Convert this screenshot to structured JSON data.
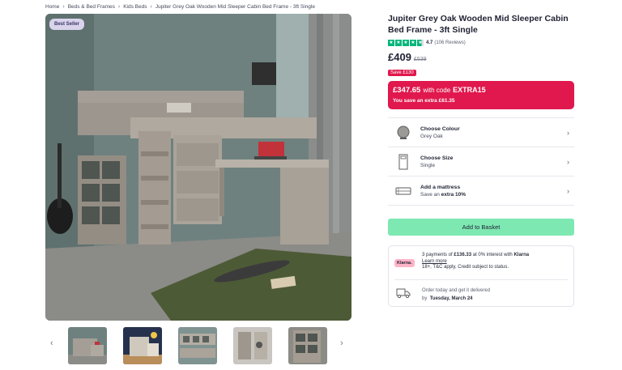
{
  "breadcrumb": {
    "items": [
      "Home",
      "Beds & Bed Frames",
      "Kids Beds",
      "Jupiter Grey Oak Wooden Mid Sleeper Cabin Bed Frame - 3ft Single"
    ],
    "separator": "›"
  },
  "gallery": {
    "badge": "Best Seller",
    "prev_arrow": "‹",
    "next_arrow": "›",
    "thumbnail_count": 5
  },
  "product": {
    "title": "Jupiter Grey Oak Wooden Mid Sleeper Cabin Bed Frame - 3ft Single",
    "rating_value": "4.7",
    "rating_stars": 4.7,
    "review_count": "(106 Reviews)",
    "price": "£409",
    "was_price": "£539",
    "save_text": "Save £130"
  },
  "promo": {
    "price": "£347.65",
    "with_code_label": "with code",
    "code": "EXTRA15",
    "extra_saving": "You save an extra £61.35"
  },
  "options": [
    {
      "label": "Choose Colour",
      "value": "Grey Oak",
      "icon": "colour-swatch-icon"
    },
    {
      "label": "Choose Size",
      "value": "Single",
      "icon": "size-icon"
    },
    {
      "label": "Add a mattress",
      "value_prefix": "Save an",
      "value_bold": "extra 10%",
      "icon": "mattress-icon"
    }
  ],
  "actions": {
    "add_to_basket": "Add to Basket"
  },
  "finance": {
    "klarna_logo": "Klarna.",
    "line1_prefix": "3 payments of",
    "line1_amount": "£136.33",
    "line1_middle": "at 0% interest with",
    "line1_brand": "Klarna",
    "learn_more": "Learn more",
    "line2": "18+, T&C apply, Credit subject to status."
  },
  "delivery": {
    "line1": "Order today and get it delivered",
    "by_label": "by",
    "date": "Tuesday, March 24"
  },
  "colors": {
    "promo_red": "#e0184d",
    "basket_green": "#7ee8b3",
    "trustpilot_green": "#00b67a",
    "klarna_pink": "#ffb3c7"
  }
}
